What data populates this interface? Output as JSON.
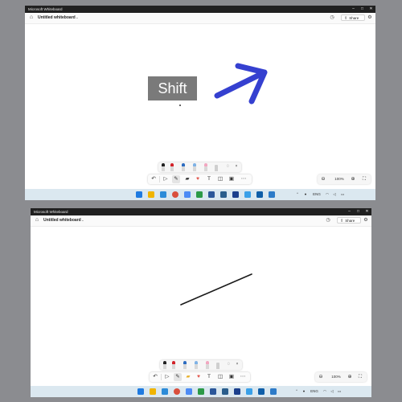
{
  "app": {
    "window_title": "Microsoft Whiteboard",
    "doc_title": "Untitled whiteboard",
    "share_label": "Share",
    "zoom_level": "100%",
    "overlay_key_label": "Shift"
  },
  "colors": {
    "titlebar": "#202020",
    "arrow_stroke": "#3540d0",
    "line_stroke": "#1a1a1a",
    "key_overlay_bg": "#7a7a7a",
    "taskbar_bg": "#dbe8f0",
    "pen_black": "#222222",
    "pen_red": "#d2232a",
    "pen_blue": "#2d6cc0",
    "pen_light_blue": "#7fb2e5",
    "pen_pink_highlighter": "#f2a7c0"
  },
  "titlebar": {
    "controls": [
      "–",
      "□",
      "✕"
    ]
  },
  "toolbar_icons": [
    "undo-icon",
    "select-icon",
    "pen-icon",
    "sticky-note-icon",
    "reactions-icon",
    "text-icon",
    "shapes-icon",
    "templates-icon",
    "more-icon"
  ],
  "pen_tray": [
    "black-pen",
    "red-pen",
    "blue-pen",
    "light-blue-pen",
    "pink-highlighter",
    "eraser",
    "lasso",
    "close"
  ],
  "taskbar_apps": [
    "start",
    "search",
    "file-explorer",
    "photos",
    "browser",
    "notepad",
    "word",
    "store",
    "whiteboard",
    "calendar",
    "edge",
    "mail"
  ],
  "system_tray": {
    "language": "ENG"
  }
}
